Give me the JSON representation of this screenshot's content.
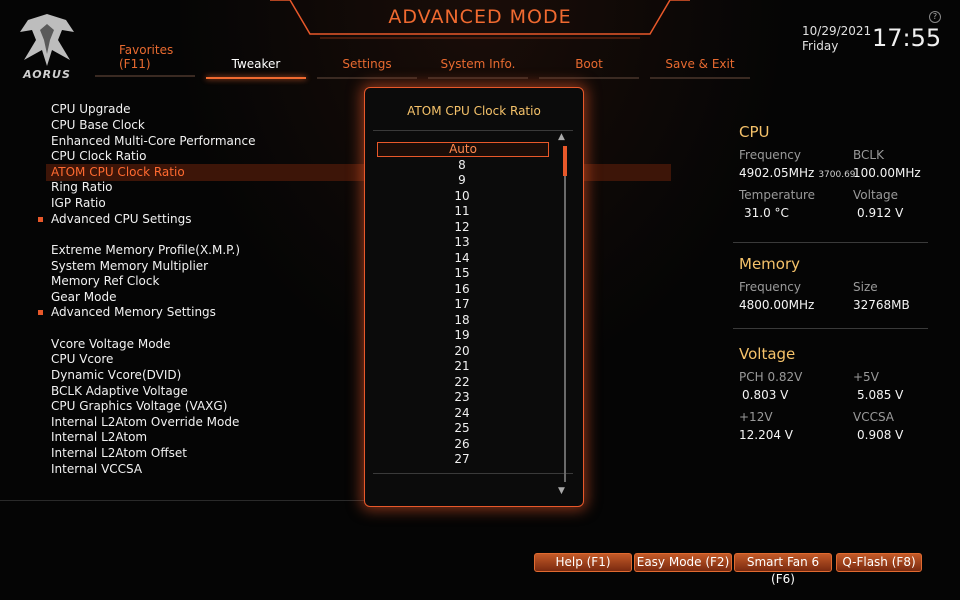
{
  "header": {
    "title": "ADVANCED MODE",
    "brand": "AORUS",
    "date": "10/29/2021",
    "day": "Friday",
    "time": "17:55",
    "help_mark": "?"
  },
  "tabs": [
    {
      "label": "Favorites",
      "sub": "(F11)"
    },
    {
      "label": "Tweaker"
    },
    {
      "label": "Settings"
    },
    {
      "label": "System Info."
    },
    {
      "label": "Boot"
    },
    {
      "label": "Save & Exit"
    }
  ],
  "menu": [
    "CPU Upgrade",
    "CPU Base Clock",
    "Enhanced Multi-Core Performance",
    "CPU Clock Ratio",
    "ATOM CPU Clock Ratio",
    "Ring Ratio",
    "IGP Ratio",
    "Advanced CPU Settings",
    "Extreme Memory Profile(X.M.P.)",
    "System Memory Multiplier",
    "Memory Ref Clock",
    "Gear Mode",
    "Advanced Memory Settings",
    "Vcore Voltage Mode",
    "CPU Vcore",
    "Dynamic Vcore(DVID)",
    "BCLK Adaptive Voltage",
    "CPU Graphics Voltage (VAXG)",
    "Internal L2Atom Override Mode",
    "Internal L2Atom",
    "Internal L2Atom Offset",
    "Internal VCCSA"
  ],
  "popup": {
    "title": "ATOM CPU Clock Ratio",
    "options": [
      "Auto",
      "8",
      "9",
      "10",
      "11",
      "12",
      "13",
      "14",
      "15",
      "16",
      "17",
      "18",
      "19",
      "20",
      "21",
      "22",
      "23",
      "24",
      "25",
      "26",
      "27"
    ],
    "selected_index": 0
  },
  "right_panel": {
    "cpu": {
      "heading": "CPU",
      "freq_label": "Frequency",
      "freq_value": "4902.05MHz",
      "freq_small": "3700.69",
      "bclk_label": "BCLK",
      "bclk_value": "100.00MHz",
      "temp_label": "Temperature",
      "temp_value": "31.0 °C",
      "volt_label": "Voltage",
      "volt_value": "0.912 V"
    },
    "memory": {
      "heading": "Memory",
      "freq_label": "Frequency",
      "freq_value": "4800.00MHz",
      "size_label": "Size",
      "size_value": "32768MB"
    },
    "voltage": {
      "heading": "Voltage",
      "pch_label": "PCH 0.82V",
      "pch_value": "0.803 V",
      "p5v_label": "+5V",
      "p5v_value": "5.085 V",
      "p12v_label": "+12V",
      "p12v_value": "12.204 V",
      "vccsa_label": "VCCSA",
      "vccsa_value": "0.908 V"
    }
  },
  "footer": {
    "help": "Help (F1)",
    "easy": "Easy Mode (F2)",
    "fan": "Smart Fan 6 (F6)",
    "qflash": "Q-Flash (F8)"
  },
  "colors": {
    "accent": "#e8582a",
    "heading": "#f5c26a",
    "highlight": "#3d1508"
  }
}
